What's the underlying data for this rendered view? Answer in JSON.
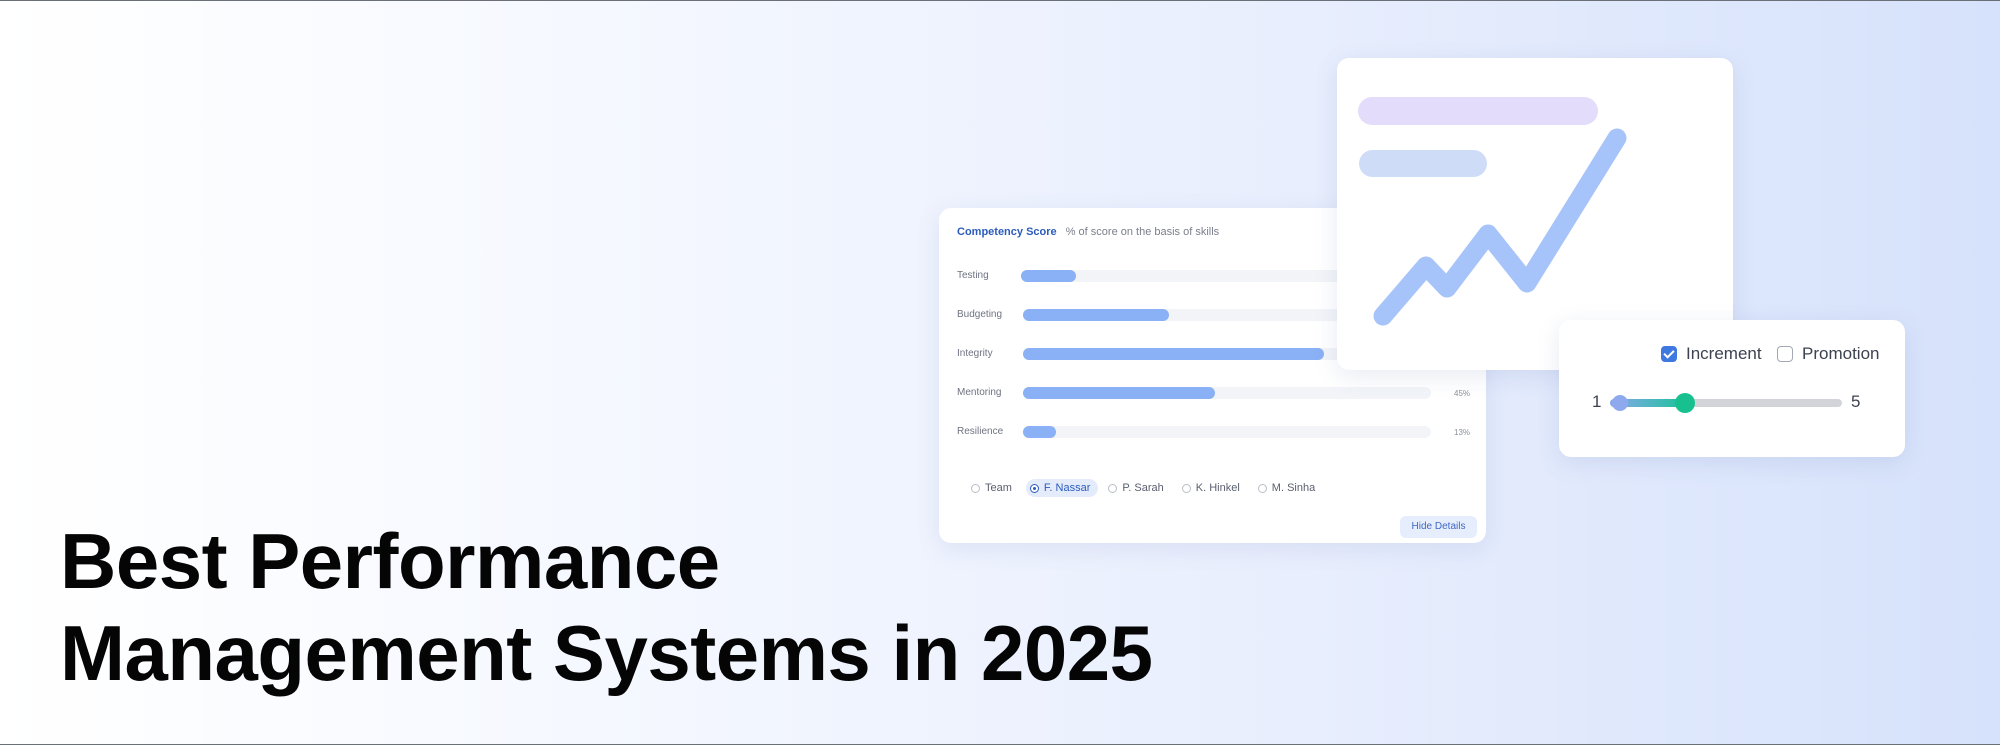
{
  "headline": {
    "line1": "Best Performance",
    "line2": "Management Systems in 2025"
  },
  "competency_card": {
    "title": "Competency Score",
    "subtitle": "% of score on the basis of skills",
    "skills": [
      {
        "label": "Testing",
        "value": 0.13,
        "pct_label": ""
      },
      {
        "label": "Budgeting",
        "value": 0.35,
        "pct_label": ""
      },
      {
        "label": "Integrity",
        "value": 0.72,
        "pct_label": ""
      },
      {
        "label": "Mentoring",
        "value": 0.47,
        "pct_label": "45%"
      },
      {
        "label": "Resilience",
        "value": 0.075,
        "pct_label": "13%"
      }
    ],
    "filters": [
      {
        "label": "Team",
        "selected": false
      },
      {
        "label": "F. Nassar",
        "selected": true
      },
      {
        "label": "P. Sarah",
        "selected": false
      },
      {
        "label": "K. Hinkel",
        "selected": false
      },
      {
        "label": "M. Sinha",
        "selected": false
      }
    ],
    "hide_button": "Hide Details"
  },
  "chart_card": {
    "trend_color": "#a7c4fa",
    "placeholder_colors": [
      "#e3dcfa",
      "#cfdcf8"
    ]
  },
  "controls_card": {
    "increment_label": "Increment",
    "increment_checked": true,
    "promotion_label": "Promotion",
    "promotion_checked": false,
    "slider_min_label": "1",
    "slider_max_label": "5",
    "range_low": 1,
    "range_high": 2.3
  },
  "colors": {
    "accent_blue": "#3f78e0",
    "bar_fill": "#8ab0f5",
    "slider_green": "#19c08f",
    "headline": "#050505"
  }
}
